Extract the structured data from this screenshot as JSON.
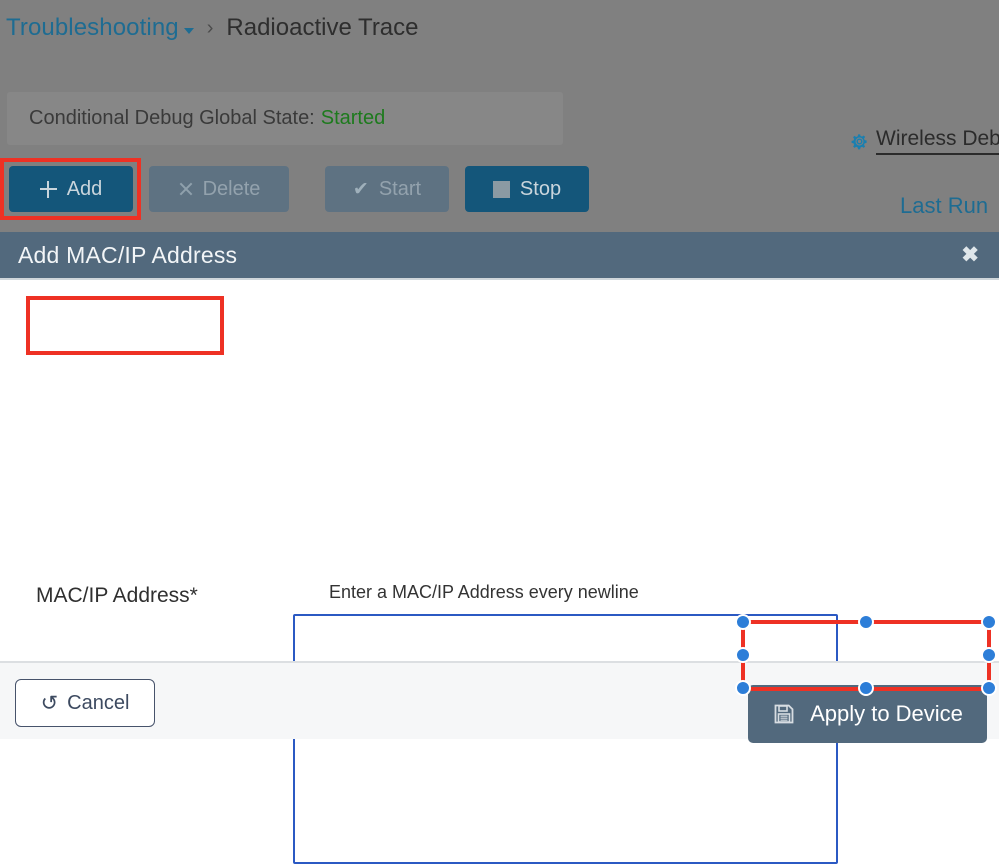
{
  "breadcrumb": {
    "parent": "Troubleshooting",
    "separator": "›",
    "current": "Radioactive Trace"
  },
  "status_panel": {
    "label": "Conditional Debug Global State:",
    "value": "Started",
    "value_color": "#1d7a1d"
  },
  "toolbar": {
    "add_label": "Add",
    "delete_label": "Delete",
    "start_label": "Start",
    "stop_label": "Stop"
  },
  "header_links": {
    "wireless_debug": "Wireless Deb",
    "last_run": "Last Run"
  },
  "modal": {
    "title": "Add MAC/IP Address",
    "close_label": "✖",
    "field_label": "MAC/IP Address*",
    "field_hint": "Enter a MAC/IP Address every newline",
    "textarea_value": "",
    "textarea_placeholder": "",
    "cancel_label": "Cancel",
    "apply_label": "Apply to Device"
  },
  "icons": {
    "plus": "plus-icon",
    "x": "x-icon",
    "check": "✔",
    "square": "stop-square-icon",
    "gear": "gear-icon",
    "undo": "↺",
    "save": "save-icon"
  },
  "colors": {
    "primary_button": "#14567a",
    "disabled_button": "#5e7282",
    "modal_header": "#52697d",
    "annotation_red": "#ee3124",
    "handle_blue": "#2d7ed8",
    "link_blue": "#1e6c92",
    "textarea_border": "#2b59c3",
    "backdrop": "#808080"
  }
}
